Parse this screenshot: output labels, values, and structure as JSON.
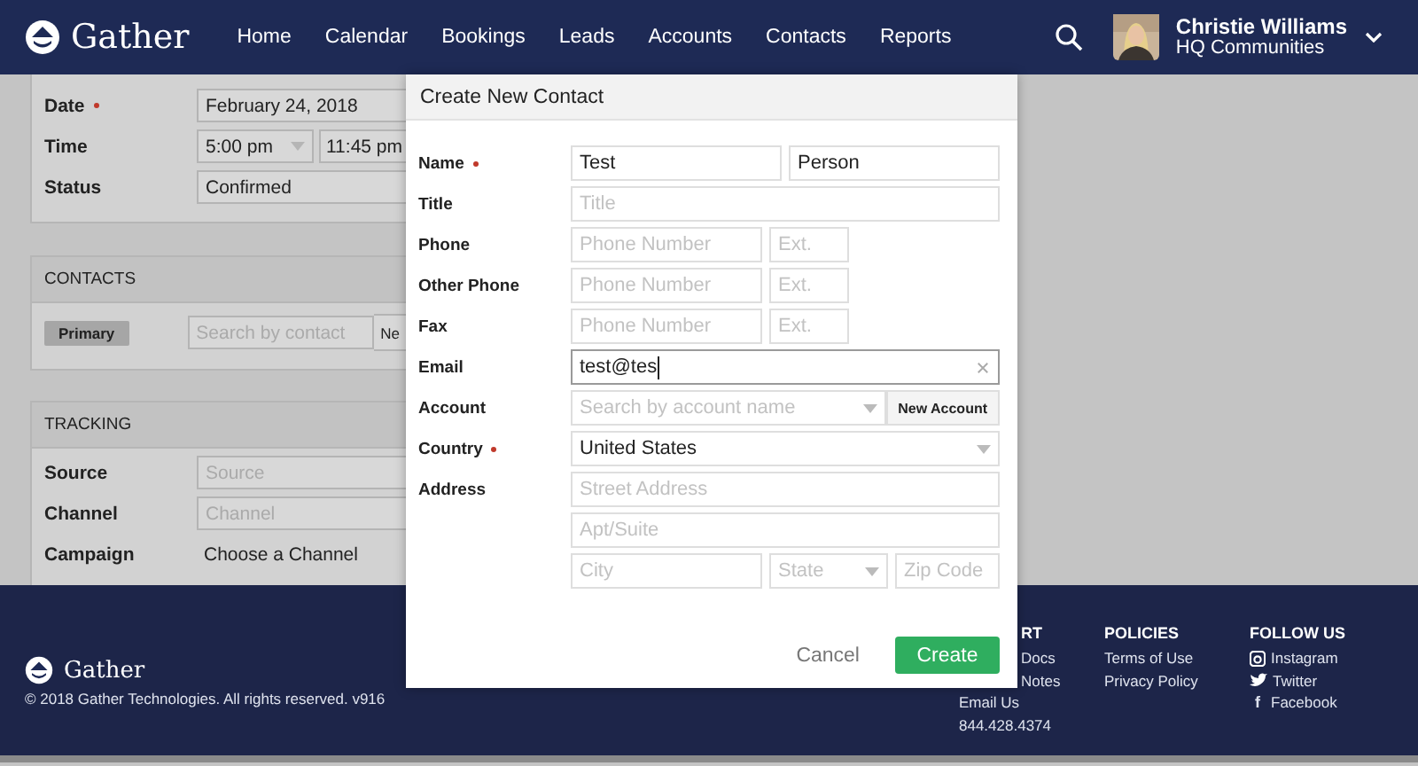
{
  "nav": {
    "brand": "Gather",
    "links": [
      "Home",
      "Calendar",
      "Bookings",
      "Leads",
      "Accounts",
      "Contacts",
      "Reports"
    ],
    "user": {
      "name": "Christie Williams",
      "org": "HQ Communities"
    }
  },
  "event_card": {
    "rows": [
      {
        "label": "Date",
        "required": true,
        "kind": "field",
        "value": "February 24, 2018"
      },
      {
        "label": "Time",
        "required": false,
        "kind": "time",
        "start": "5:00 pm",
        "end": "11:45 pm"
      },
      {
        "label": "Status",
        "required": false,
        "kind": "field",
        "value": "Confirmed"
      }
    ]
  },
  "contacts_card": {
    "heading": "CONTACTS",
    "tag": "Primary",
    "search_placeholder": "Search by contact",
    "button": "Ne"
  },
  "tracking_card": {
    "heading": "TRACKING",
    "rows": [
      {
        "label": "Source",
        "kind": "field",
        "placeholder": "Source"
      },
      {
        "label": "Channel",
        "kind": "field",
        "placeholder": "Channel"
      },
      {
        "label": "Campaign",
        "kind": "text",
        "value": "Choose a Channel"
      }
    ]
  },
  "modal": {
    "title": "Create New Contact",
    "rows": [
      {
        "label": "Name",
        "required": true,
        "kind": "pair",
        "fields": [
          {
            "kind": "input",
            "value": "Test"
          },
          {
            "kind": "input",
            "value": "Person"
          }
        ]
      },
      {
        "label": "Title",
        "required": false,
        "kind": "single",
        "fields": [
          {
            "kind": "input",
            "placeholder": "Title"
          }
        ]
      },
      {
        "label": "Phone",
        "required": false,
        "kind": "phone",
        "fields": [
          {
            "kind": "input",
            "placeholder": "Phone Number"
          },
          {
            "kind": "input",
            "placeholder": "Ext."
          }
        ]
      },
      {
        "label": "Other Phone",
        "required": false,
        "kind": "phone",
        "fields": [
          {
            "kind": "input",
            "placeholder": "Phone Number"
          },
          {
            "kind": "input",
            "placeholder": "Ext."
          }
        ]
      },
      {
        "label": "Fax",
        "required": false,
        "kind": "phone",
        "fields": [
          {
            "kind": "input",
            "placeholder": "Phone Number"
          },
          {
            "kind": "input",
            "placeholder": "Ext."
          }
        ]
      },
      {
        "label": "Email",
        "required": false,
        "kind": "single",
        "fields": [
          {
            "kind": "clearable",
            "value": "test@tes",
            "focused": true
          }
        ]
      },
      {
        "label": "Account",
        "required": false,
        "kind": "account",
        "fields": [
          {
            "kind": "select",
            "placeholder": "Search by account name"
          },
          {
            "kind": "button",
            "value": "New Account"
          }
        ]
      },
      {
        "label": "Country",
        "required": true,
        "kind": "single",
        "fields": [
          {
            "kind": "select",
            "value": "United States"
          }
        ]
      },
      {
        "label": "Address",
        "required": false,
        "kind": "single",
        "fields": [
          {
            "kind": "input",
            "placeholder": "Street Address"
          }
        ]
      },
      {
        "kind": "single",
        "fields": [
          {
            "kind": "input",
            "placeholder": "Apt/Suite"
          }
        ]
      },
      {
        "kind": "city",
        "fields": [
          {
            "kind": "input",
            "placeholder": "City"
          },
          {
            "kind": "select",
            "placeholder": "State"
          },
          {
            "kind": "input",
            "placeholder": "Zip Code"
          }
        ]
      }
    ],
    "cancel": "Cancel",
    "create": "Create"
  },
  "footer": {
    "brand": "Gather",
    "copyright": "© 2018 Gather Technologies. All rights reserved. v916",
    "columns": [
      {
        "heading": "RT",
        "heading_partial": true,
        "items": [
          {
            "text": "Docs",
            "partial": true
          },
          {
            "text": "Notes",
            "partial": true
          },
          {
            "text": "Email Us",
            "partial": false
          },
          {
            "text": "844.428.4374",
            "partial": false
          }
        ]
      },
      {
        "heading": "POLICIES",
        "heading_partial": false,
        "items": [
          {
            "text": "Terms of Use",
            "partial": false
          },
          {
            "text": "Privacy Policy",
            "partial": false
          }
        ]
      },
      {
        "heading": "FOLLOW US",
        "heading_partial": false,
        "items": [
          {
            "text": "Instagram",
            "partial": false,
            "kind": "camera"
          },
          {
            "text": "Twitter",
            "partial": false,
            "kind": "bird"
          },
          {
            "text": "Facebook",
            "partial": false,
            "kind": "glyph",
            "glyph": "f"
          }
        ]
      }
    ]
  }
}
